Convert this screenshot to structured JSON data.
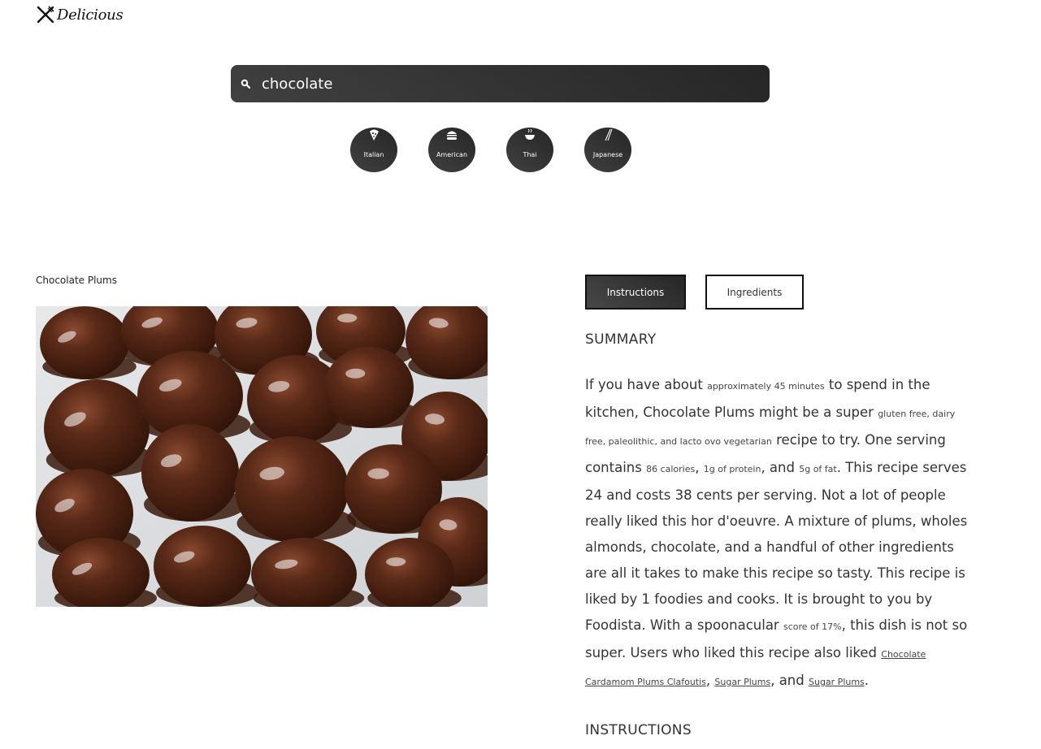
{
  "brand": {
    "name": "Delicious",
    "logo_icon": "fork-knife-icon"
  },
  "search": {
    "value": "chocolate",
    "icon": "search-icon"
  },
  "cuisines": [
    {
      "label": "Italian",
      "icon": "pizza-icon"
    },
    {
      "label": "American",
      "icon": "burger-icon"
    },
    {
      "label": "Thai",
      "icon": "noodle-bowl-icon"
    },
    {
      "label": "Japanese",
      "icon": "chopsticks-icon"
    }
  ],
  "recipe": {
    "title": "Chocolate Plums",
    "image": "chocolate-covered-plums-photo"
  },
  "tabs": {
    "instructions": "Instructions",
    "ingredients": "Ingredients",
    "active": "Instructions"
  },
  "summary": {
    "heading": "SUMMARY",
    "t1": "If you have about ",
    "time": "approximately 45 minutes",
    "t2": " to spend in the kitchen, Chocolate Plums might be a super ",
    "diets": "gluten free, dairy free, paleolithic, and lacto ovo vegetarian",
    "t3": " recipe to try. One serving contains ",
    "calories": "86 calories",
    "sep1": ", ",
    "protein": "1g of protein",
    "sep2": ", and ",
    "fat": "5g of fat",
    "t4": ". This recipe serves 24 and costs 38 cents per serving. Not a lot of people really liked this hor d'oeuvre. A mixture of plums, wholes almonds, chocolate, and a handful of other ingredients are all it takes to make this recipe so tasty. This recipe is liked by 1 foodies and cooks. It is brought to you by Foodista. With a spoonacular ",
    "score": "score of 17%",
    "t5": ", this dish is not so super. Users who liked this recipe also liked ",
    "link1": "Chocolate Cardamom Plums Clafoutis",
    "sep3": ", ",
    "link2": "Sugar Plums",
    "sep4": ", and ",
    "link3": "Sugar Plums",
    "end": "."
  },
  "instructions_heading": "INSTRUCTIONS",
  "colors": {
    "dark_gradient_start": "#404040",
    "dark_gradient_end": "#262626",
    "text": "#333333"
  }
}
